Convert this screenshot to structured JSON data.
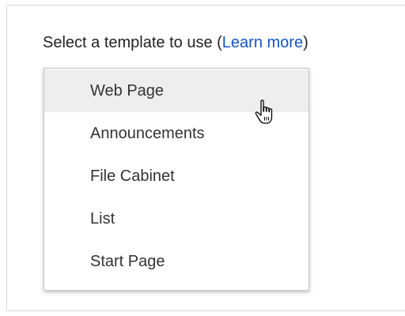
{
  "header": {
    "prompt": "Select a template to use (",
    "learn_more": "Learn more",
    "close_paren": ")"
  },
  "menu": {
    "hovered_index": 0,
    "items": [
      {
        "label": "Web Page"
      },
      {
        "label": "Announcements"
      },
      {
        "label": "File Cabinet"
      },
      {
        "label": "List"
      },
      {
        "label": "Start Page"
      }
    ]
  },
  "colors": {
    "link": "#1155cc",
    "hover_background": "#eeeeee",
    "text": "#333333"
  },
  "icons": {
    "cursor": "hand-pointer-icon"
  }
}
